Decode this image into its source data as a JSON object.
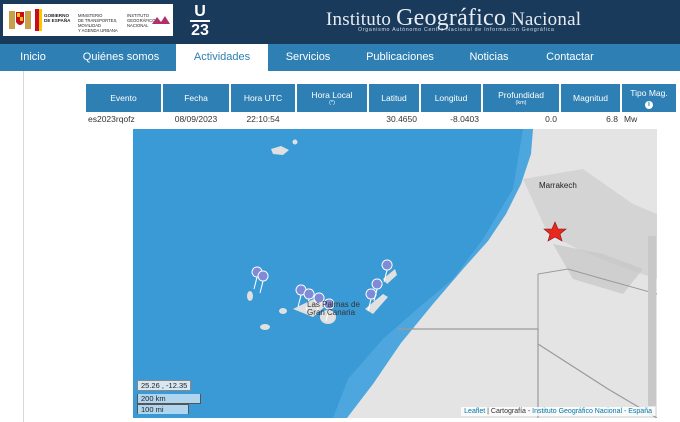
{
  "header": {
    "gov_lines": [
      "GOBIERNO",
      "DE ESPAÑA"
    ],
    "ministry_lines": [
      "MINISTERIO",
      "DE TRANSPORTES, MOVILIDAD",
      "Y AGENDA URBANA"
    ],
    "ign_small_lines": [
      "INSTITUTO",
      "GEOGRÁFICO",
      "NACIONAL"
    ],
    "u23_top": "U",
    "u23_bottom": "23",
    "title_parts": [
      "Instituto",
      "Geográfico",
      "Nacional"
    ],
    "subtitle": "Organismo Autónomo  Centro Nacional de Información Geográfica"
  },
  "nav": {
    "items": [
      {
        "label": "Inicio",
        "active": false
      },
      {
        "label": "Quiénes somos",
        "active": false
      },
      {
        "label": "Actividades",
        "active": true
      },
      {
        "label": "Servicios",
        "active": false
      },
      {
        "label": "Publicaciones",
        "active": false
      },
      {
        "label": "Noticias",
        "active": false
      },
      {
        "label": "Contactar",
        "active": false
      }
    ]
  },
  "table": {
    "headers": {
      "evento": "Evento",
      "fecha": "Fecha",
      "hora_utc": "Hora UTC",
      "hora_local": "Hora Local",
      "hora_local_unit": "(*)",
      "latitud": "Latitud",
      "longitud": "Longitud",
      "profundidad": "Profundidad",
      "profundidad_unit": "(km)",
      "magnitud": "Magnitud",
      "tipo_mag": "Tipo Mag."
    },
    "row": {
      "evento": "es2023rqofz",
      "fecha": "08/09/2023",
      "hora_utc": "22:10:54",
      "hora_local": "",
      "latitud": "30.4650",
      "longitud": "-8.0403",
      "profundidad": "0.0",
      "magnitud": "6.8",
      "tipo_mag": "Mw"
    }
  },
  "map": {
    "place_marrakech": "Marrakech",
    "place_lp_1": "Las Palmas de",
    "place_lp_2": "Gran Canaria",
    "coords": "25.26 , -12.35",
    "scale_km": "200 km",
    "scale_mi": "100 mi",
    "attrib_leaflet": "Leaflet",
    "attrib_sep": " | Cartografía - ",
    "attrib_ign": "Instituto Geográfico Nacional - España",
    "colors": {
      "ocean": "#3a9ad6",
      "land": "#e6e6e6",
      "epicenter": "#e8281e"
    }
  },
  "colors": {
    "header_bg": "#1a3a5c",
    "nav_bg": "#2e7fb3",
    "table_header_bg": "#2e7fb3"
  }
}
